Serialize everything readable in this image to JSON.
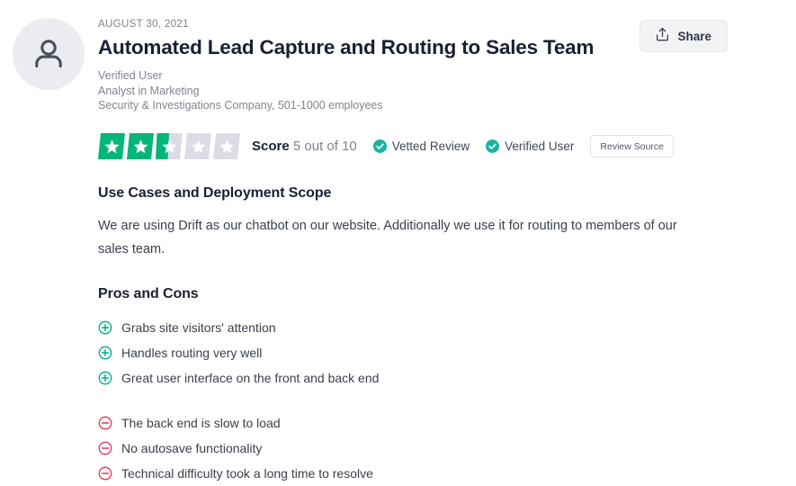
{
  "colors": {
    "star_filled": "#00b67a",
    "star_empty": "#dcdce6",
    "pro_icon": "#00a98f",
    "con_icon": "#e8375a",
    "badge_check": "#1ab5a2",
    "title": "#1b1f32",
    "muted_text": "#82858e",
    "avatar_bg": "#ebecef"
  },
  "header": {
    "date": "AUGUST 30, 2021",
    "title": "Automated Lead Capture and Routing to Sales Team",
    "avatar_icon": "person-icon",
    "reviewer": {
      "verified_label": "Verified User",
      "role": "Analyst in Marketing",
      "company": "Security & Investigations Company, 501-1000 employees"
    },
    "share_button": {
      "label": "Share",
      "icon": "share-upload-icon"
    }
  },
  "score": {
    "label": "Score",
    "value_text": "5 out of 10",
    "value": 5,
    "out_of": 10,
    "stars_total": 5,
    "stars_filled": 2.5,
    "badges": [
      {
        "label": "Vetted Review",
        "icon": "check-circle-icon"
      },
      {
        "label": "Verified User",
        "icon": "check-circle-icon"
      }
    ],
    "review_source_button": "Review Source"
  },
  "sections": [
    {
      "heading": "Use Cases and Deployment Scope",
      "body": "We are using Drift as our chatbot on our website. Additionally we use it for routing to members of our sales team."
    }
  ],
  "pros_cons": {
    "heading": "Pros and Cons",
    "pros_icon": "plus-circle-icon",
    "cons_icon": "minus-circle-icon",
    "pros": [
      "Grabs site visitors' attention",
      "Handles routing very well",
      "Great user interface on the front and back end"
    ],
    "cons": [
      "The back end is slow to load",
      "No autosave functionality",
      "Technical difficulty took a long time to resolve"
    ]
  }
}
